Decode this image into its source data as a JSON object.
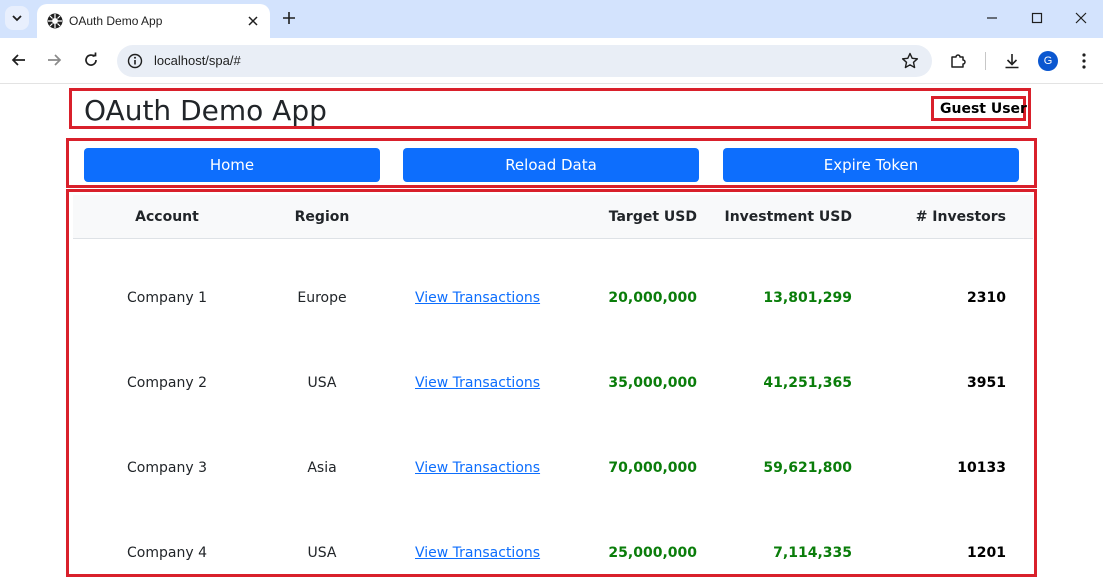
{
  "browser": {
    "tab_title": "OAuth Demo App",
    "url": "localhost/spa/#",
    "profile_initial": "G"
  },
  "app": {
    "title": "OAuth Demo App",
    "user": "Guest User"
  },
  "buttons": {
    "home": "Home",
    "reload": "Reload Data",
    "expire": "Expire Token"
  },
  "table": {
    "headers": {
      "account": "Account",
      "region": "Region",
      "target": "Target USD",
      "investment": "Investment USD",
      "investors": "# Investors"
    },
    "rows": [
      {
        "account": "Company 1",
        "region": "Europe",
        "link": "View Transactions",
        "target": "20,000,000",
        "investment": "13,801,299",
        "investors": "2310"
      },
      {
        "account": "Company 2",
        "region": "USA",
        "link": "View Transactions",
        "target": "35,000,000",
        "investment": "41,251,365",
        "investors": "3951"
      },
      {
        "account": "Company 3",
        "region": "Asia",
        "link": "View Transactions",
        "target": "70,000,000",
        "investment": "59,621,800",
        "investors": "10133"
      },
      {
        "account": "Company 4",
        "region": "USA",
        "link": "View Transactions",
        "target": "25,000,000",
        "investment": "7,114,335",
        "investors": "1201"
      }
    ]
  },
  "colors": {
    "button": "#0d6efd",
    "highlight_border": "#d9202b",
    "money": "#0a7d0a",
    "link": "#0d6efd"
  }
}
